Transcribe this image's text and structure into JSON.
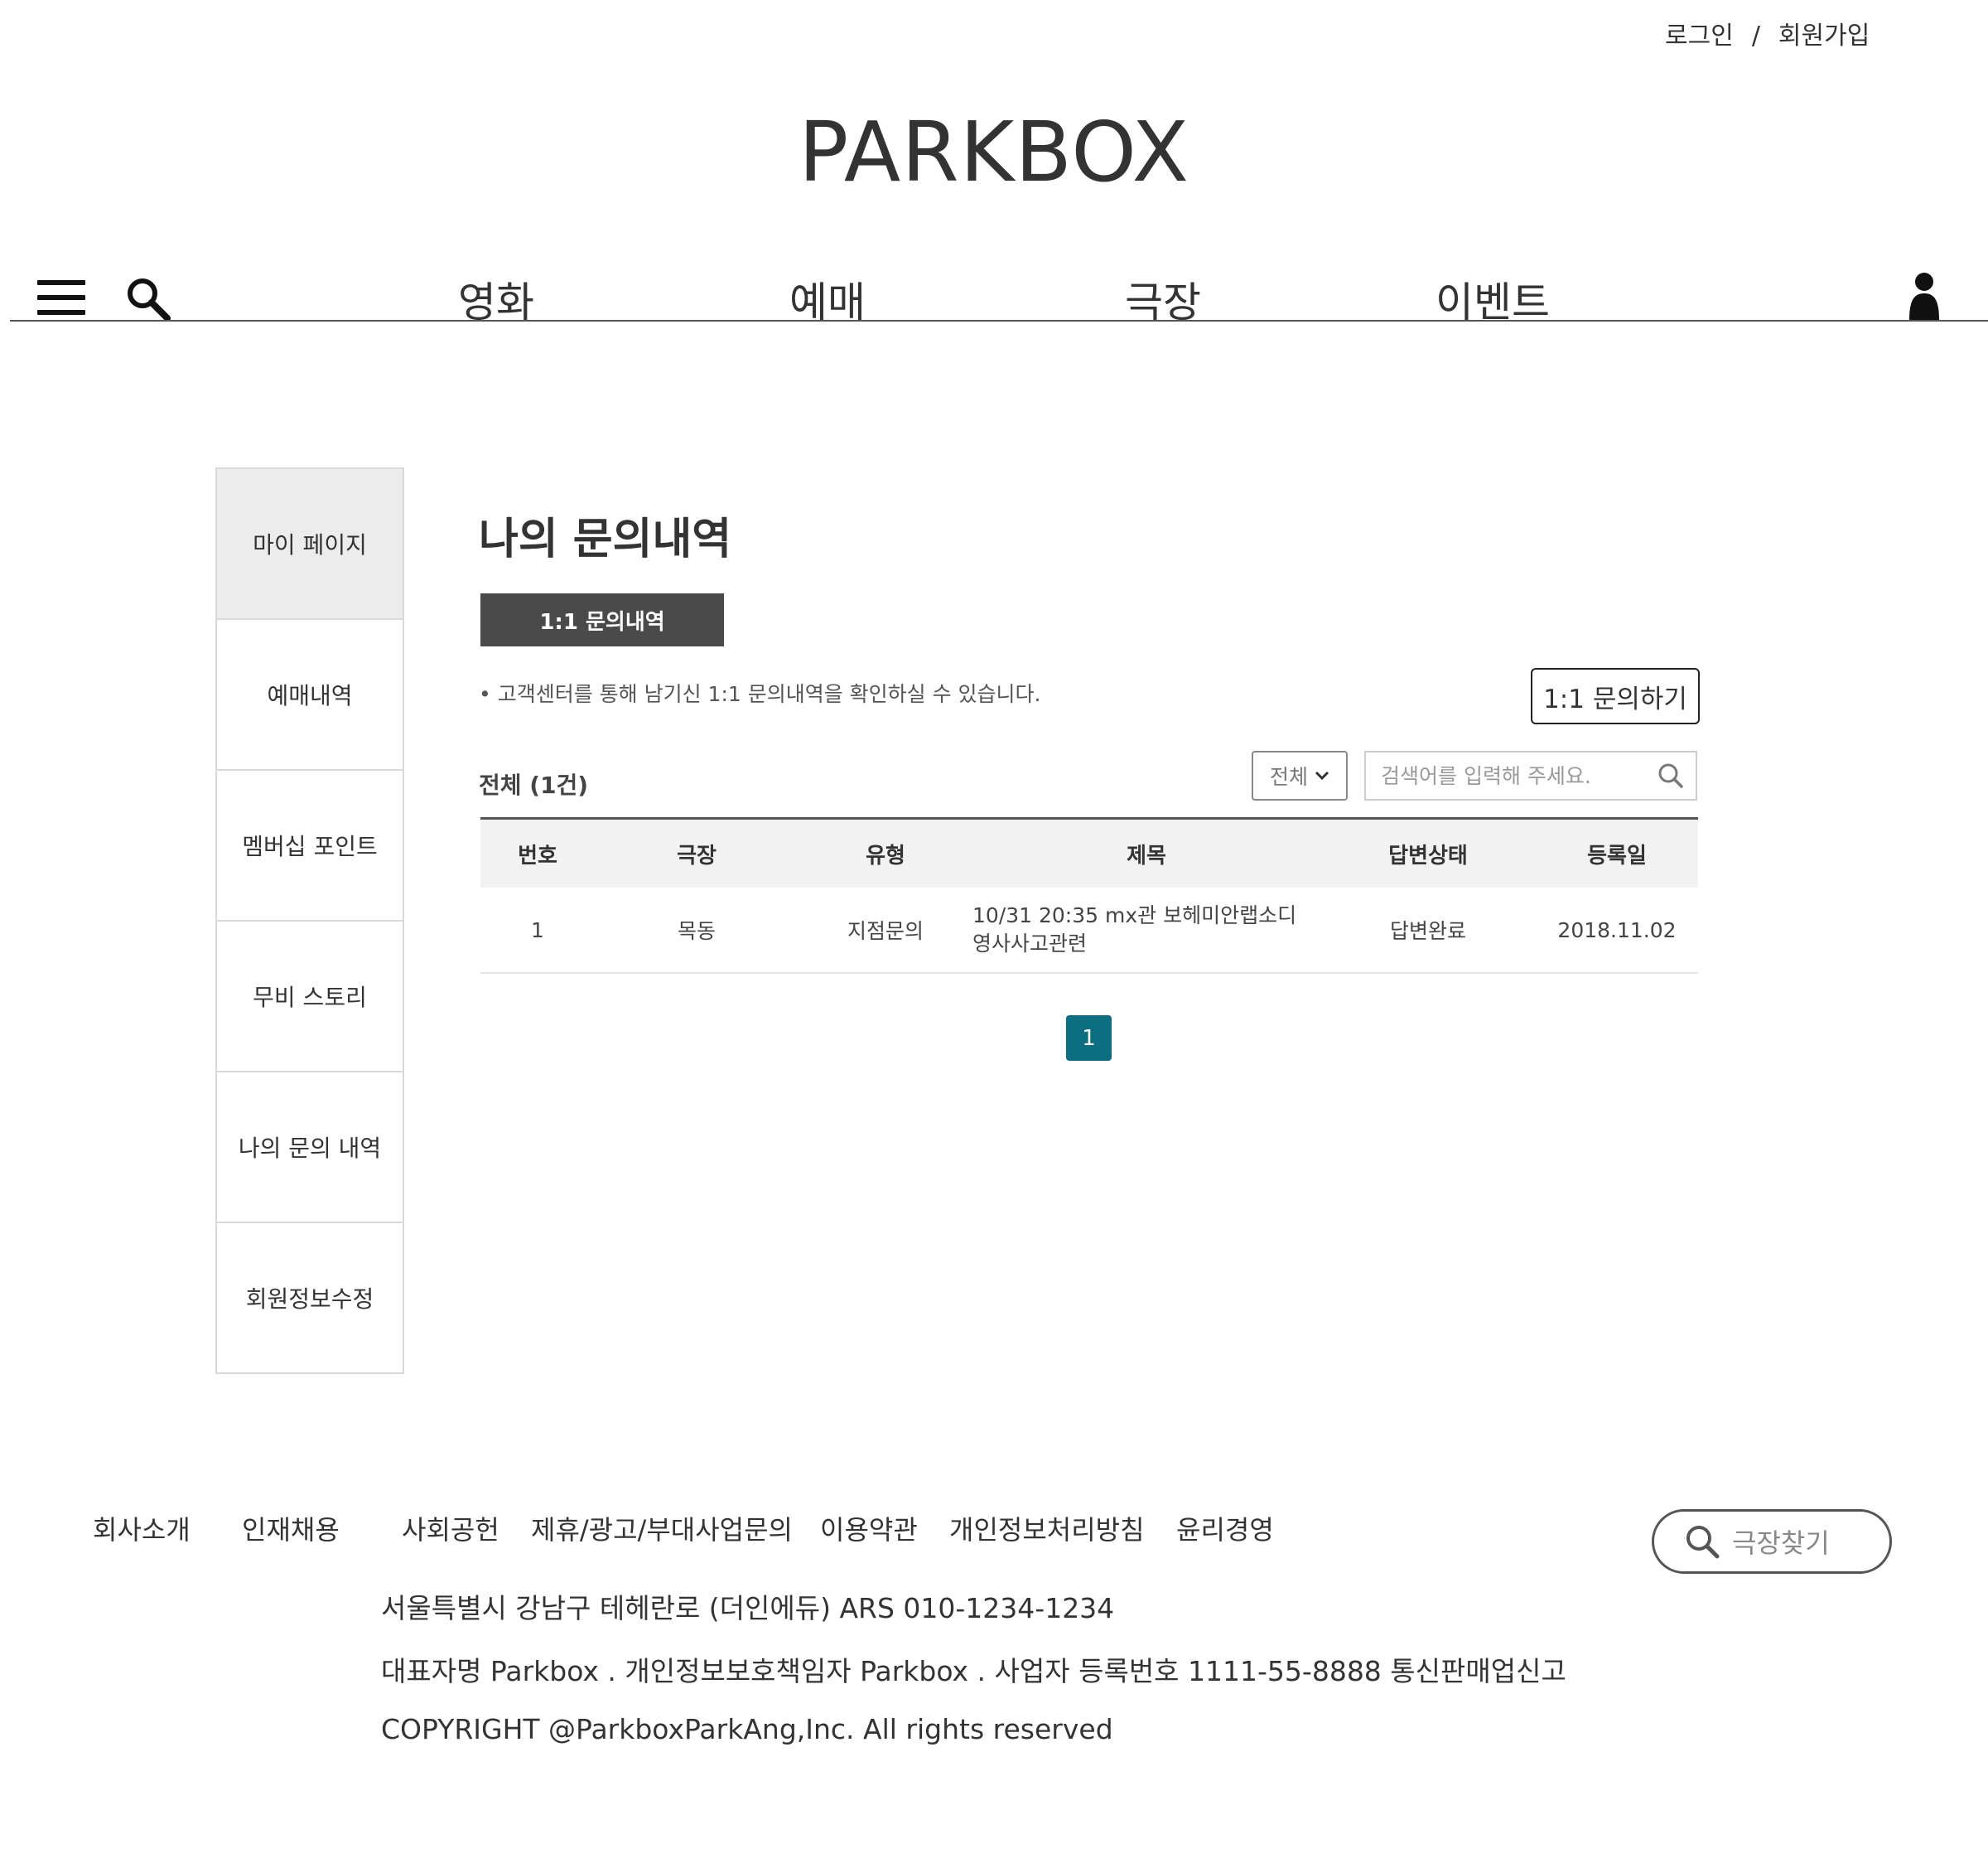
{
  "header": {
    "login": "로그인",
    "separator": "/",
    "signup": "회원가입",
    "logo": "PARKBOX"
  },
  "nav": {
    "items": [
      "영화",
      "예매",
      "극장",
      "이벤트"
    ],
    "icons": {
      "menu": "hamburger-menu-icon",
      "search": "search-icon",
      "user": "user-icon"
    }
  },
  "sidebar": {
    "items": [
      {
        "label": "마이 페이지",
        "active": true
      },
      {
        "label": "예매내역"
      },
      {
        "label": "멤버십 포인트"
      },
      {
        "label": "무비 스토리"
      },
      {
        "label": "나의 문의 내역"
      },
      {
        "label": "회원정보수정"
      }
    ]
  },
  "main": {
    "title": "나의 문의내역",
    "tab_label": "1:1 문의내역",
    "notice": "• 고객센터를 통해 남기신 1:1 문의내역을 확인하실 수 있습니다.",
    "inquire_button": "1:1 문의하기",
    "count": "전체 (1건)",
    "filter_selected": "전체",
    "search_placeholder": "검색어를 입력해 주세요."
  },
  "table": {
    "headers": [
      "번호",
      "극장",
      "유형",
      "제목",
      "답변상태",
      "등록일"
    ],
    "rows": [
      {
        "no": "1",
        "theater": "목동",
        "type": "지점문의",
        "title_line1": "10/31 20:35 mx관 보헤미안랩소디",
        "title_line2": "영사사고관련",
        "status": "답변완료",
        "date": "2018.11.02"
      }
    ]
  },
  "pagination": {
    "current": "1"
  },
  "footer": {
    "links": [
      "회사소개",
      "인재채용",
      "사회공헌",
      "제휴/광고/부대사업문의",
      "이용약관",
      "개인정보처리방침",
      "윤리경영"
    ],
    "address": "서울특별시 강남구 테헤란로 (더인에듀) ARS 010-1234-1234",
    "info": "대표자명 Parkbox . 개인정보보호책임자 Parkbox . 사업자 등록번호 1111-55-8888 통신판매업신고",
    "copyright": "COPYRIGHT @ParkboxParkAng,Inc. All rights reserved",
    "theater_button": "극장찾기"
  },
  "colors": {
    "accent": "#0d6e82",
    "tab_bg": "#4a4a4a",
    "active_side_bg": "#ececec"
  }
}
